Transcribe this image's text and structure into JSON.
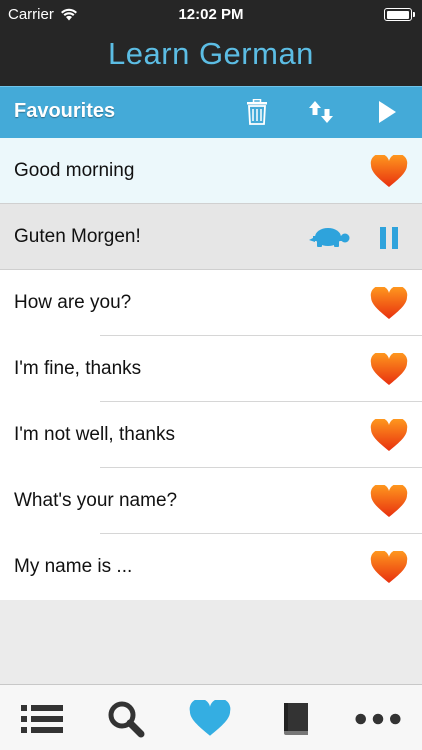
{
  "status": {
    "carrier": "Carrier",
    "time": "12:02 PM"
  },
  "app": {
    "title": "Learn German"
  },
  "section": {
    "title": "Favourites"
  },
  "colors": {
    "accent": "#44aad8",
    "title_text": "#5cbde4",
    "heart": "#f0501e"
  },
  "phrases": [
    {
      "text": "Good morning",
      "state": "selected",
      "favourite": true
    },
    {
      "text": "Guten Morgen!",
      "state": "translation-playing",
      "favourite": false
    },
    {
      "text": "How are you?",
      "state": "normal",
      "favourite": true
    },
    {
      "text": "I'm fine, thanks",
      "state": "normal",
      "favourite": true
    },
    {
      "text": "I'm not well, thanks",
      "state": "normal",
      "favourite": true
    },
    {
      "text": "What's your name?",
      "state": "normal",
      "favourite": true
    },
    {
      "text": "My name is ...",
      "state": "normal",
      "favourite": true
    }
  ],
  "toolbar_icons": [
    "trash-icon",
    "sort-icon",
    "play-icon"
  ],
  "tabs": [
    {
      "icon": "list-icon",
      "active": false
    },
    {
      "icon": "search-icon",
      "active": false
    },
    {
      "icon": "heart-icon",
      "active": true
    },
    {
      "icon": "book-icon",
      "active": false
    },
    {
      "icon": "more-icon",
      "active": false
    }
  ]
}
